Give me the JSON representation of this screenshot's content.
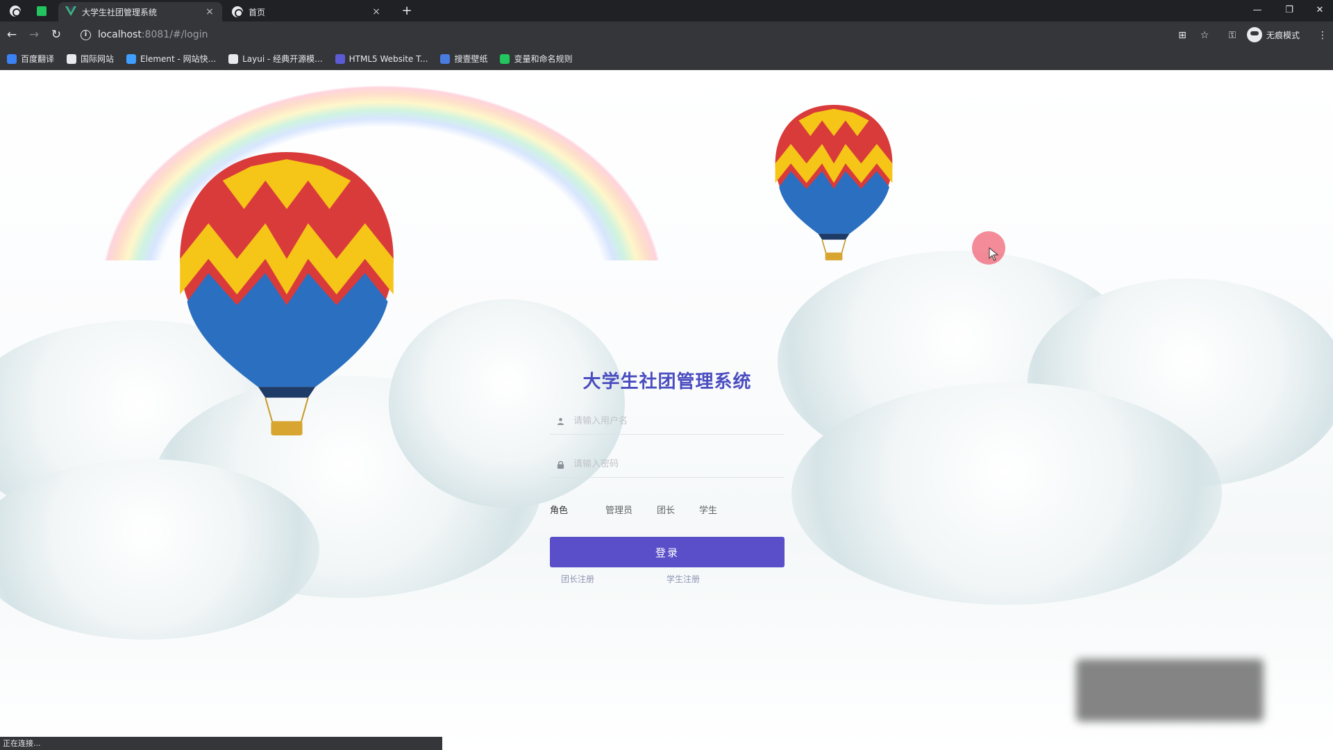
{
  "browser": {
    "tabs": [
      {
        "title": "大学生社团管理系统",
        "active": true
      },
      {
        "title": "首页",
        "active": false
      }
    ],
    "new_tab_label": "+",
    "close_label": "×",
    "url_host": "localhost",
    "url_rest": ":8081/#/login",
    "profile_label": "无痕模式",
    "bookmarks": [
      {
        "label": "百度翻译",
        "color": "#3b82f6"
      },
      {
        "label": "国际网站",
        "color": "#e8eaed"
      },
      {
        "label": "Element - 网站快...",
        "color": "#409eff"
      },
      {
        "label": "Layui - 经典开源模...",
        "color": "#e8eaed"
      },
      {
        "label": "HTML5 Website T...",
        "color": "#5b5bd6"
      },
      {
        "label": "搜壹壁纸",
        "color": "#4a7be0"
      },
      {
        "label": "变量和命名规则",
        "color": "#22c55e"
      }
    ],
    "status_text": "正在连接..."
  },
  "login": {
    "title": "大学生社团管理系统",
    "username_placeholder": "请输入用户名",
    "password_placeholder": "请输入密码",
    "role_label": "角色",
    "roles": [
      "管理员",
      "团长",
      "学生"
    ],
    "submit_label": "登录",
    "links": [
      "团长注册",
      "学生注册"
    ]
  },
  "colors": {
    "accent": "#5a4fc9",
    "title": "#4a4dbf"
  },
  "icons": {
    "user": "user-icon",
    "lock": "lock-icon"
  }
}
